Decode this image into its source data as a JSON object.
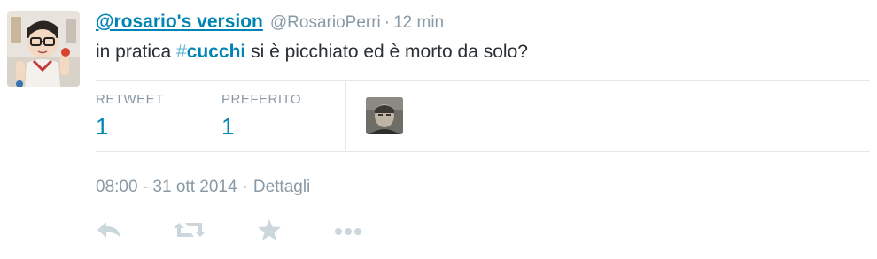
{
  "tweet": {
    "fullname": "@rosario's version",
    "username": "@RosarioPerri",
    "separator": "·",
    "time_ago": "12 min",
    "text_before": "in pratica ",
    "hashtag_symbol": "#",
    "hashtag_word": "cucchi",
    "text_after": " si è picchiato ed è morto da solo?"
  },
  "stats": {
    "retweet_label": "RETWEET",
    "retweet_count": "1",
    "favorite_label": "PREFERITO",
    "favorite_count": "1"
  },
  "meta": {
    "timestamp": "08:00 - 31 ott 2014",
    "separator": "·",
    "details_label": "Dettagli"
  },
  "actions": {
    "icons": [
      "reply-icon",
      "retweet-icon",
      "favorite-star-icon",
      "more-dots-icon"
    ]
  },
  "colors": {
    "link": "#0084b4",
    "muted": "#8899a6",
    "text": "#292f33",
    "divider": "#e1e8ed",
    "action_icon": "#ccd6dd"
  }
}
